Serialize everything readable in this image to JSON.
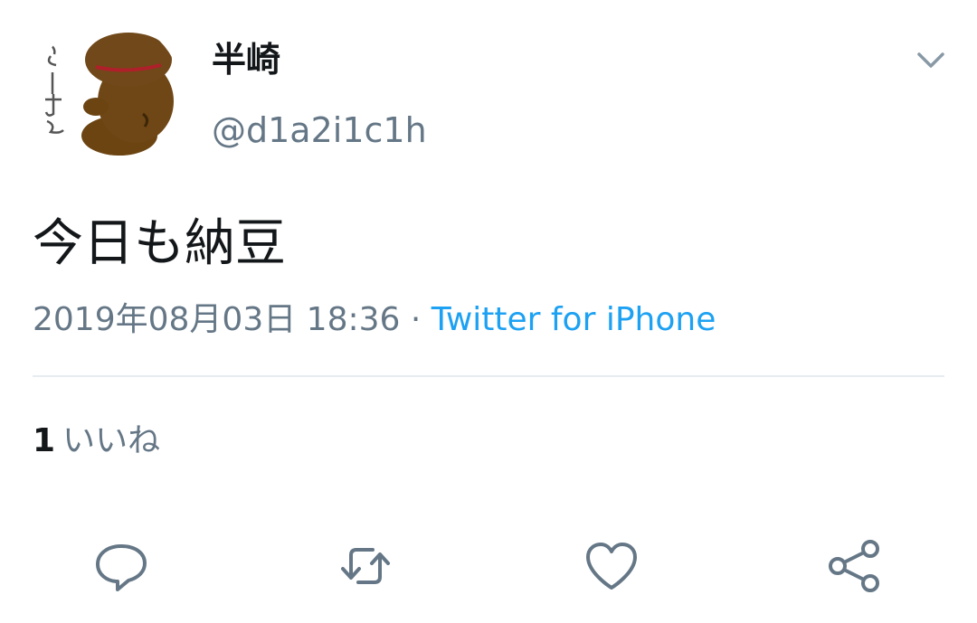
{
  "tweet": {
    "author": {
      "display_name": "半崎",
      "handle": "@d1a2i1c1h"
    },
    "text": "今日も納豆",
    "timestamp": "2019年08月03日 18:36",
    "separator": " · ",
    "source": "Twitter for iPhone",
    "likes": {
      "count": "1",
      "label": "いいね"
    }
  },
  "icons": {
    "menu": "chevron-down-icon",
    "reply": "reply-icon",
    "retweet": "retweet-icon",
    "like": "heart-icon",
    "share": "share-icon"
  },
  "colors": {
    "text_primary": "#14171a",
    "text_secondary": "#657786",
    "link": "#1da1f2",
    "divider": "#e6ecf0",
    "icon": "#657786"
  }
}
